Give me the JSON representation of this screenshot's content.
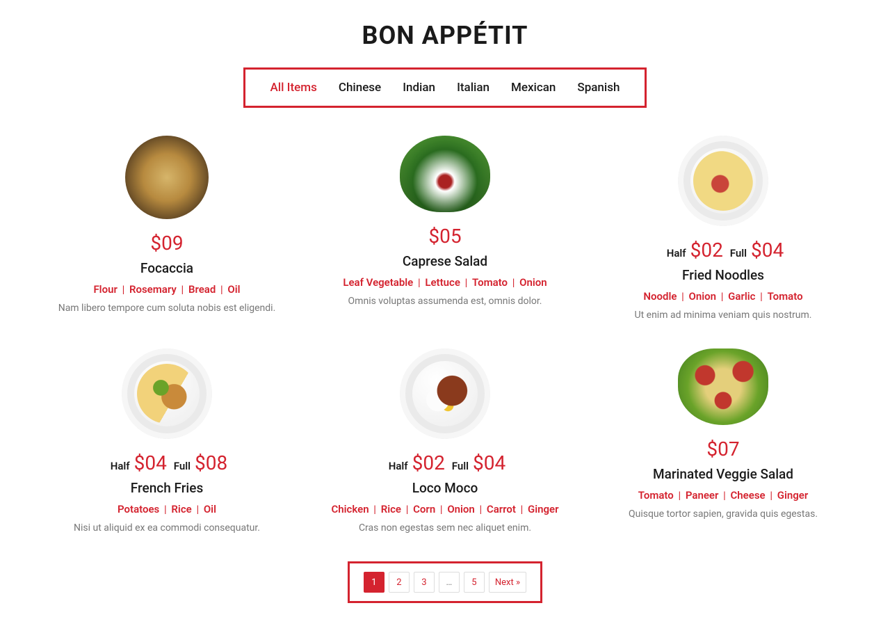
{
  "title": "BON APPÉTIT",
  "colors": {
    "accent": "#d4232f"
  },
  "filters": {
    "items": [
      {
        "label": "All Items",
        "active": true
      },
      {
        "label": "Chinese",
        "active": false
      },
      {
        "label": "Indian",
        "active": false
      },
      {
        "label": "Italian",
        "active": false
      },
      {
        "label": "Mexican",
        "active": false
      },
      {
        "label": "Spanish",
        "active": false
      }
    ]
  },
  "menu": [
    {
      "name": "Focaccia",
      "prices": [
        {
          "label": "",
          "value": "$09"
        }
      ],
      "ingredients": [
        "Flour",
        "Rosemary",
        "Bread",
        "Oil"
      ],
      "description": "Nam libero tempore cum soluta nobis est eligendi."
    },
    {
      "name": "Caprese Salad",
      "prices": [
        {
          "label": "",
          "value": "$05"
        }
      ],
      "ingredients": [
        "Leaf Vegetable",
        "Lettuce",
        "Tomato",
        "Onion"
      ],
      "description": "Omnis voluptas assumenda est, omnis dolor."
    },
    {
      "name": "Fried Noodles",
      "prices": [
        {
          "label": "Half",
          "value": "$02"
        },
        {
          "label": "Full",
          "value": "$04"
        }
      ],
      "ingredients": [
        "Noodle",
        "Onion",
        "Garlic",
        "Tomato"
      ],
      "description": "Ut enim ad minima veniam quis nostrum."
    },
    {
      "name": "French Fries",
      "prices": [
        {
          "label": "Half",
          "value": "$04"
        },
        {
          "label": "Full",
          "value": "$08"
        }
      ],
      "ingredients": [
        "Potatoes",
        "Rice",
        "Oil"
      ],
      "description": "Nisi ut aliquid ex ea commodi consequatur."
    },
    {
      "name": "Loco Moco",
      "prices": [
        {
          "label": "Half",
          "value": "$02"
        },
        {
          "label": "Full",
          "value": "$04"
        }
      ],
      "ingredients": [
        "Chicken",
        "Rice",
        "Corn",
        "Onion",
        "Carrot",
        "Ginger"
      ],
      "description": "Cras non egestas sem nec aliquet enim."
    },
    {
      "name": "Marinated Veggie Salad",
      "prices": [
        {
          "label": "",
          "value": "$07"
        }
      ],
      "ingredients": [
        "Tomato",
        "Paneer",
        "Cheese",
        "Ginger"
      ],
      "description": "Quisque tortor sapien, gravida quis egestas."
    }
  ],
  "pagination": {
    "pages": [
      "1",
      "2",
      "3",
      "…",
      "5"
    ],
    "active": "1",
    "next_label": "Next »"
  }
}
